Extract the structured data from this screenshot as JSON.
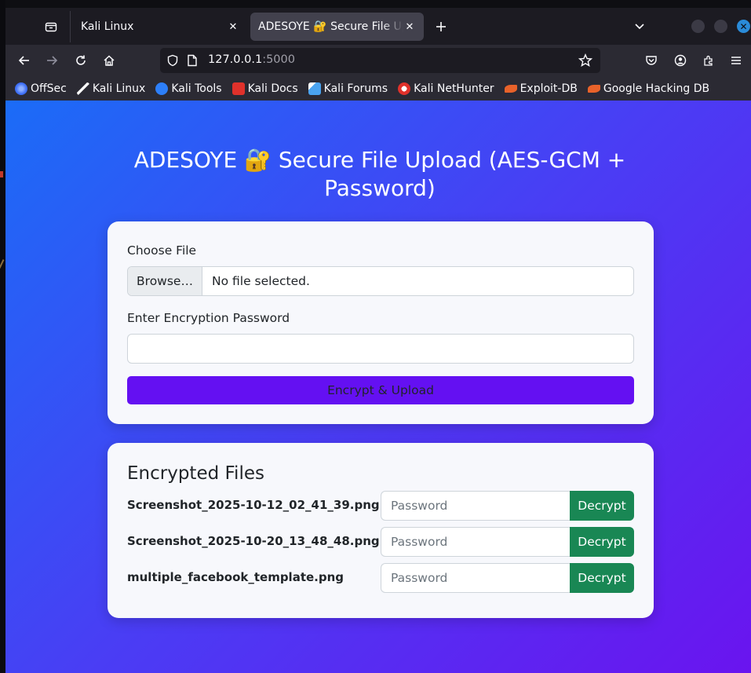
{
  "browser": {
    "tabs": [
      {
        "title": "Kali Linux",
        "active": false
      },
      {
        "title": "ADESOYE 🔐 Secure File Upload",
        "active": true
      }
    ],
    "url_host": "127.0.0.1",
    "url_port": ":5000",
    "bookmarks": [
      {
        "label": "OffSec",
        "icon": "offsec-icon",
        "color": "#3d6ef5"
      },
      {
        "label": "Kali Linux",
        "icon": "kali-dragon-icon",
        "color": "#ffffff"
      },
      {
        "label": "Kali Tools",
        "icon": "kali-tools-icon",
        "color": "#2d7ff9"
      },
      {
        "label": "Kali Docs",
        "icon": "kali-docs-icon",
        "color": "#e0312b"
      },
      {
        "label": "Kali Forums",
        "icon": "kali-forums-icon",
        "color": "#4aa3f0"
      },
      {
        "label": "Kali NetHunter",
        "icon": "nethunter-icon",
        "color": "#e0312b"
      },
      {
        "label": "Exploit-DB",
        "icon": "exploit-db-icon",
        "color": "#e8622a"
      },
      {
        "label": "Google Hacking DB",
        "icon": "ghdb-icon",
        "color": "#e8622a"
      }
    ]
  },
  "page": {
    "heading": "ADESOYE 🔐 Secure File Upload (AES-GCM + Password)",
    "upload": {
      "choose_file_label": "Choose File",
      "browse_label": "Browse…",
      "file_status": "No file selected.",
      "password_label": "Enter Encryption Password",
      "password_value": "",
      "submit_label": "Encrypt & Upload"
    },
    "files": {
      "title": "Encrypted Files",
      "password_placeholder": "Password",
      "decrypt_label": "Decrypt",
      "items": [
        {
          "name": "Screenshot_2025-10-12_02_41_39.png"
        },
        {
          "name": "Screenshot_2025-10-20_13_48_48.png"
        },
        {
          "name": "multiple_facebook_template.png"
        }
      ]
    }
  },
  "colors": {
    "gradient_start": "#1b6cf7",
    "gradient_end": "#6a14ef",
    "primary_button": "#6410f2",
    "decrypt_button": "#198754"
  }
}
